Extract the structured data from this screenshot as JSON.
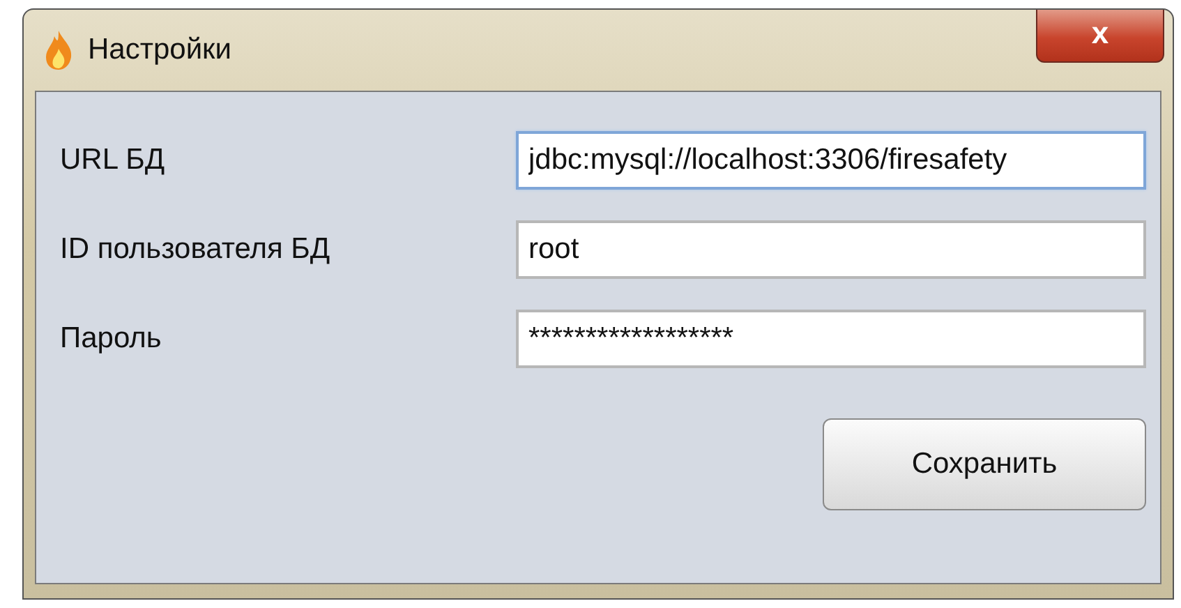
{
  "window": {
    "title": "Настройки",
    "close_symbol": "x"
  },
  "fields": [
    {
      "label": "URL БД",
      "value": "jdbc:mysql://localhost:3306/firesafety",
      "focused": true
    },
    {
      "label": "ID пользователя БД",
      "value": "root",
      "focused": false
    },
    {
      "label": "Пароль",
      "value": "******************",
      "focused": false
    }
  ],
  "buttons": [
    "Сохранить"
  ]
}
